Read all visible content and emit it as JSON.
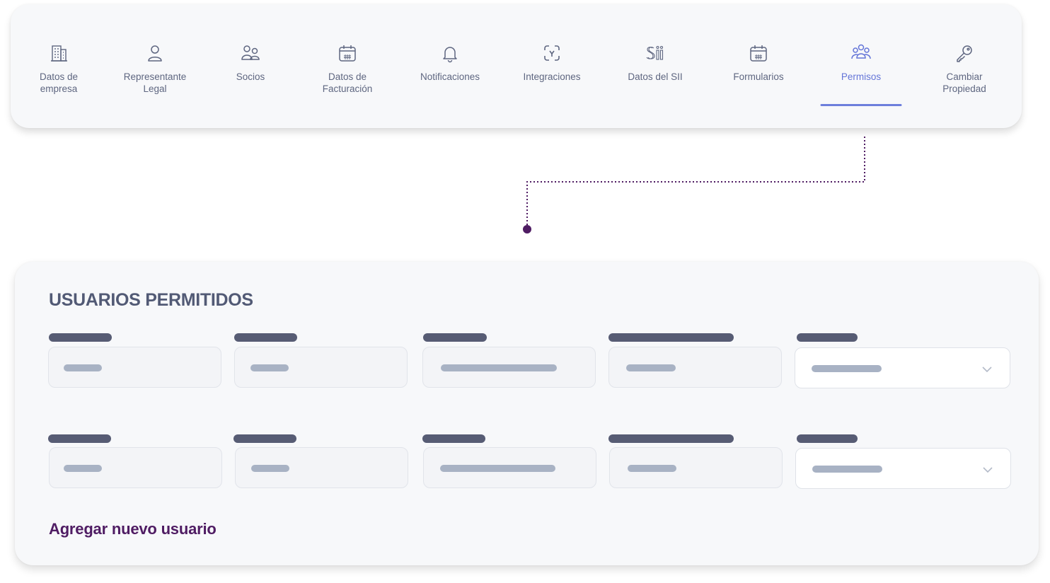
{
  "nav": {
    "active_color": "#6475d8",
    "inactive_color": "#5e6680",
    "tabs": [
      {
        "label": "Datos de\nempresa",
        "icon": "building-icon"
      },
      {
        "label": "Representante\nLegal",
        "icon": "user-icon"
      },
      {
        "label": "Socios",
        "icon": "users-icon"
      },
      {
        "label": "Datos de\nFacturación",
        "icon": "calendar-icon"
      },
      {
        "label": "Notificaciones",
        "icon": "bell-icon"
      },
      {
        "label": "Integraciones",
        "icon": "integrations-icon"
      },
      {
        "label": "Datos del SII",
        "icon": "sii-logo-icon"
      },
      {
        "label": "Formularios",
        "icon": "calendar-icon"
      },
      {
        "label": "Permisos",
        "icon": "team-icon",
        "active": true
      },
      {
        "label": "Cambiar\nPropiedad",
        "icon": "key-icon"
      }
    ]
  },
  "users": {
    "title": "USUARIOS PERMITIDOS",
    "add_label": "Agregar nuevo usuario",
    "link_color": "#4f1c63"
  }
}
